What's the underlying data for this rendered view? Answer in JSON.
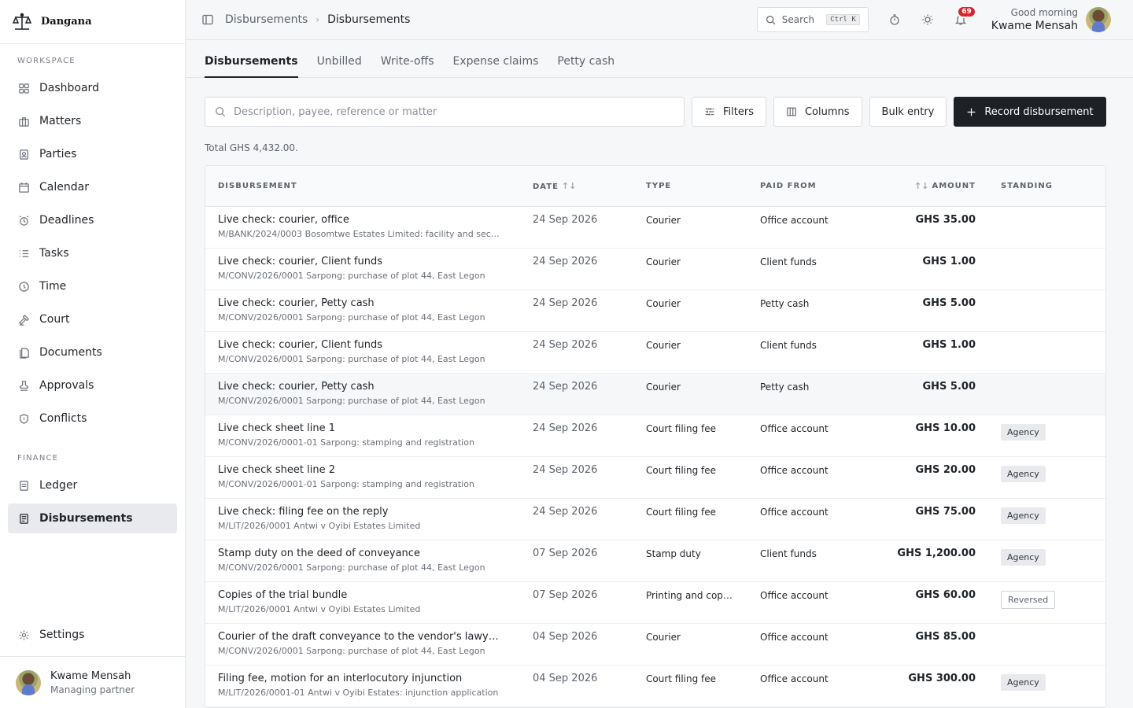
{
  "app": {
    "name": "Dangana"
  },
  "sidebar": {
    "workspace_label": "WORKSPACE",
    "workspace_items": [
      {
        "label": "Dashboard",
        "icon": "grid-icon"
      },
      {
        "label": "Matters",
        "icon": "briefcase-icon"
      },
      {
        "label": "Parties",
        "icon": "contact-card-icon"
      },
      {
        "label": "Calendar",
        "icon": "calendar-icon"
      },
      {
        "label": "Deadlines",
        "icon": "alarm-clock-icon"
      },
      {
        "label": "Tasks",
        "icon": "list-icon"
      },
      {
        "label": "Time",
        "icon": "clock-icon"
      },
      {
        "label": "Court",
        "icon": "gavel-icon"
      },
      {
        "label": "Documents",
        "icon": "documents-icon"
      },
      {
        "label": "Approvals",
        "icon": "stamp-icon"
      },
      {
        "label": "Conflicts",
        "icon": "shield-icon"
      }
    ],
    "finance_label": "FINANCE",
    "finance_items": [
      {
        "label": "Ledger",
        "icon": "ledger-icon"
      },
      {
        "label": "Disbursements",
        "icon": "receipt-icon",
        "active": true
      }
    ],
    "settings_label": "Settings",
    "user": {
      "name": "Kwame Mensah",
      "role": "Managing partner"
    }
  },
  "topbar": {
    "breadcrumb": [
      "Disbursements",
      "Disbursements"
    ],
    "search_label": "Search",
    "search_shortcut": "Ctrl K",
    "notification_count": "69",
    "greeting": "Good morning",
    "user_name": "Kwame Mensah"
  },
  "tabs": [
    "Disbursements",
    "Unbilled",
    "Write-offs",
    "Expense claims",
    "Petty cash"
  ],
  "toolbar": {
    "search_placeholder": "Description, payee, reference or matter",
    "filters_label": "Filters",
    "columns_label": "Columns",
    "bulk_label": "Bulk entry",
    "record_label": "Record disbursement"
  },
  "total_text": "Total GHS 4,432.00.",
  "table": {
    "headers": {
      "desc": "DISBURSEMENT",
      "date": "DATE",
      "type": "TYPE",
      "paid": "PAID FROM",
      "amount": "AMOUNT",
      "standing": "STANDING"
    },
    "rows": [
      {
        "title": "Live check: courier, office",
        "sub": "M/BANK/2024/0003 Bosomtwe Estates Limited: facility and sec…",
        "date": "24 Sep 2026",
        "type": "Courier",
        "paid": "Office account",
        "amount": "GHS 35.00",
        "standing": ""
      },
      {
        "title": "Live check: courier, Client funds",
        "sub": "M/CONV/2026/0001 Sarpong: purchase of plot 44, East Legon",
        "date": "24 Sep 2026",
        "type": "Courier",
        "paid": "Client funds",
        "amount": "GHS 1.00",
        "standing": ""
      },
      {
        "title": "Live check: courier, Petty cash",
        "sub": "M/CONV/2026/0001 Sarpong: purchase of plot 44, East Legon",
        "date": "24 Sep 2026",
        "type": "Courier",
        "paid": "Petty cash",
        "amount": "GHS 5.00",
        "standing": ""
      },
      {
        "title": "Live check: courier, Client funds",
        "sub": "M/CONV/2026/0001 Sarpong: purchase of plot 44, East Legon",
        "date": "24 Sep 2026",
        "type": "Courier",
        "paid": "Client funds",
        "amount": "GHS 1.00",
        "standing": ""
      },
      {
        "title": "Live check: courier, Petty cash",
        "sub": "M/CONV/2026/0001 Sarpong: purchase of plot 44, East Legon",
        "date": "24 Sep 2026",
        "type": "Courier",
        "paid": "Petty cash",
        "amount": "GHS 5.00",
        "standing": ""
      },
      {
        "title": "Live check sheet line 1",
        "sub": "M/CONV/2026/0001-01 Sarpong: stamping and registration",
        "date": "24 Sep 2026",
        "type": "Court filing fee",
        "paid": "Office account",
        "amount": "GHS 10.00",
        "standing": "Agency"
      },
      {
        "title": "Live check sheet line 2",
        "sub": "M/CONV/2026/0001-01 Sarpong: stamping and registration",
        "date": "24 Sep 2026",
        "type": "Court filing fee",
        "paid": "Office account",
        "amount": "GHS 20.00",
        "standing": "Agency"
      },
      {
        "title": "Live check: filing fee on the reply",
        "sub": "M/LIT/2026/0001 Antwi v Oyibi Estates Limited",
        "date": "24 Sep 2026",
        "type": "Court filing fee",
        "paid": "Office account",
        "amount": "GHS 75.00",
        "standing": "Agency"
      },
      {
        "title": "Stamp duty on the deed of conveyance",
        "sub": "M/CONV/2026/0001 Sarpong: purchase of plot 44, East Legon",
        "date": "07 Sep 2026",
        "type": "Stamp duty",
        "paid": "Client funds",
        "amount": "GHS 1,200.00",
        "standing": "Agency"
      },
      {
        "title": "Copies of the trial bundle",
        "sub": "M/LIT/2026/0001 Antwi v Oyibi Estates Limited",
        "date": "07 Sep 2026",
        "type": "Printing and cop…",
        "paid": "Office account",
        "amount": "GHS 60.00",
        "standing": "Reversed"
      },
      {
        "title": "Courier of the draft conveyance to the vendor's lawy…",
        "sub": "M/CONV/2026/0001 Sarpong: purchase of plot 44, East Legon",
        "date": "04 Sep 2026",
        "type": "Courier",
        "paid": "Office account",
        "amount": "GHS 85.00",
        "standing": ""
      },
      {
        "title": "Filing fee, motion for an interlocutory injunction",
        "sub": "M/LIT/2026/0001-01 Antwi v Oyibi Estates: injunction application",
        "date": "04 Sep 2026",
        "type": "Court filing fee",
        "paid": "Office account",
        "amount": "GHS 300.00",
        "standing": "Agency"
      }
    ]
  }
}
